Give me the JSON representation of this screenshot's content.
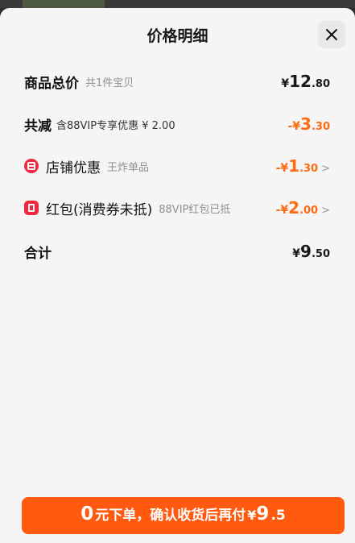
{
  "header": {
    "title": "价格明细"
  },
  "rows": {
    "goods_total": {
      "label": "商品总价",
      "sub": "共1件宝贝",
      "yen": "¥",
      "int": "12",
      "dec": ".80"
    },
    "total_reduce": {
      "label": "共减",
      "sub": "含88VIP专享优惠 ¥ 2.00",
      "yen": "-¥",
      "int": "3",
      "dec": ".30"
    },
    "shop_discount": {
      "label": "店铺优惠",
      "sub": "王炸单品",
      "yen": "-¥",
      "int": "1",
      "dec": ".30"
    },
    "red_packet": {
      "label": "红包(消费券未抵)",
      "sub": "88VIP红包已抵",
      "yen": "-¥",
      "int": "2",
      "dec": ".00"
    },
    "total": {
      "label": "合计",
      "yen": "¥",
      "int": "9",
      "dec": ".50"
    }
  },
  "cta": {
    "zero": "0",
    "text": "元下单，确认收货后再付",
    "yen": "¥",
    "int": "9",
    "dec": ".5"
  },
  "colors": {
    "accent": "#ff6b13",
    "button": "#ff5a10",
    "badge": "#f0273f"
  },
  "icons": {
    "close": "close-icon",
    "shop": "shop-discount-icon",
    "redpack": "red-packet-icon",
    "chevron": "chevron-right-icon"
  }
}
